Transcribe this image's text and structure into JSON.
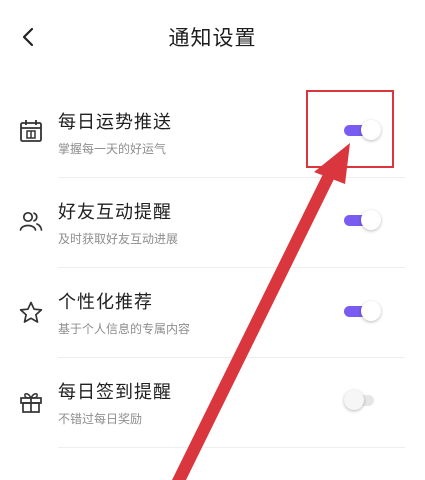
{
  "header": {
    "title": "通知设置",
    "back_icon": "chevron-left-icon"
  },
  "settings": [
    {
      "title": "每日运势推送",
      "subtitle": "掌握每一天的好运气",
      "icon": "calendar-icon",
      "enabled": true
    },
    {
      "title": "好友互动提醒",
      "subtitle": "及时获取好友互动进展",
      "icon": "users-icon",
      "enabled": true
    },
    {
      "title": "个性化推荐",
      "subtitle": "基于个人信息的专属内容",
      "icon": "star-icon",
      "enabled": true
    },
    {
      "title": "每日签到提醒",
      "subtitle": "不错过每日奖励",
      "icon": "gift-icon",
      "enabled": false
    }
  ],
  "colors": {
    "toggle_on": "#7a5cf0",
    "toggle_off": "#e6e6e6",
    "annotation": "#d9363e"
  }
}
